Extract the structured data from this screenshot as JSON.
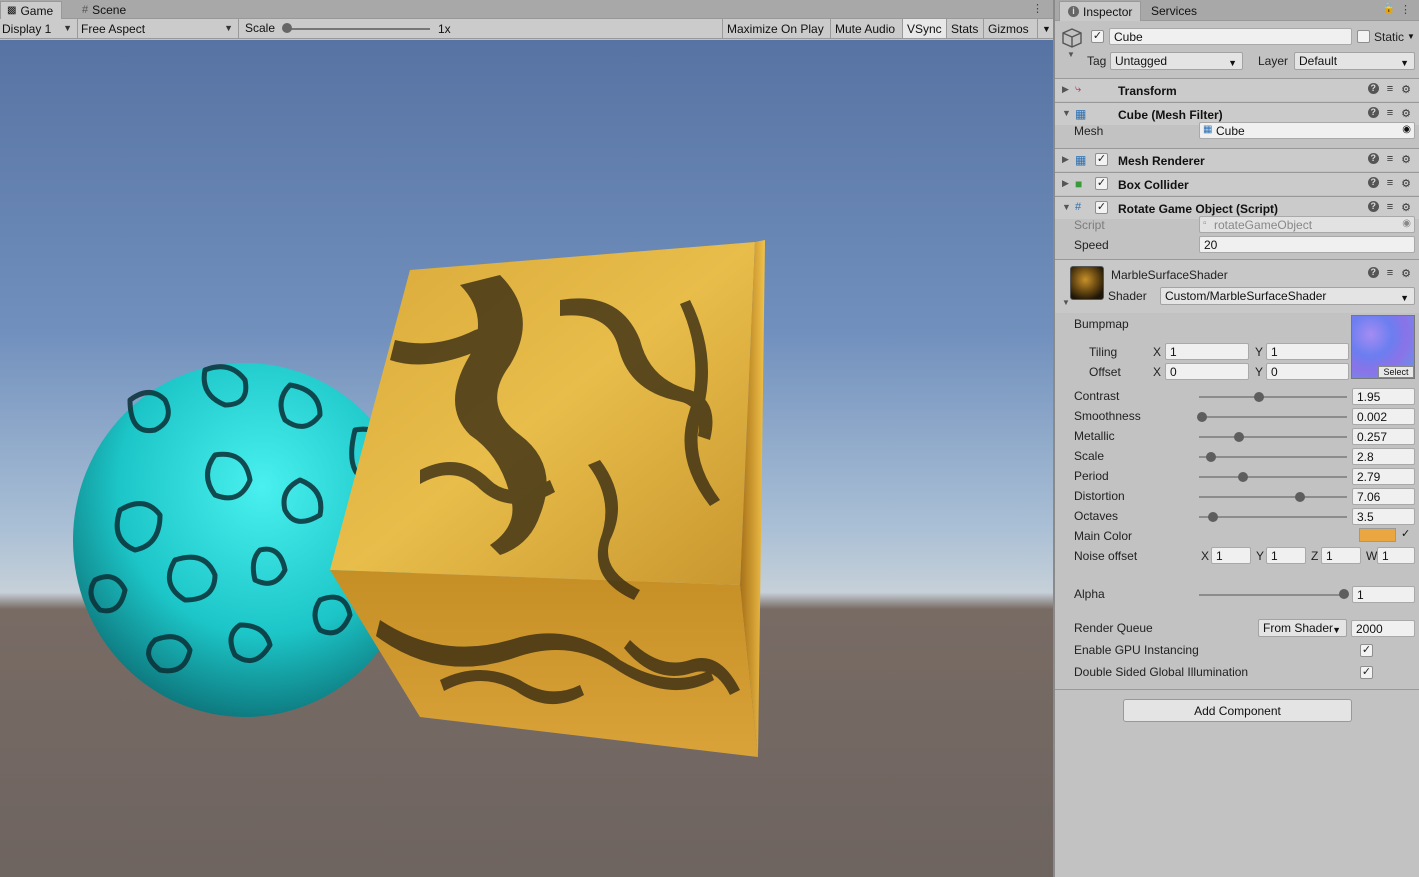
{
  "game_view": {
    "tabs": [
      {
        "label": "Game",
        "icon": "gamepad-icon",
        "active": true
      },
      {
        "label": "Scene",
        "icon": "grid-icon",
        "active": false
      }
    ],
    "toolbar": {
      "display": "Display 1",
      "aspect": "Free Aspect",
      "scale_label": "Scale",
      "scale_value": "1x",
      "buttons": [
        "Maximize On Play",
        "Mute Audio",
        "VSync",
        "Stats",
        "Gizmos"
      ]
    }
  },
  "inspector": {
    "tabs": [
      {
        "label": "Inspector",
        "icon": "info-icon",
        "active": true
      },
      {
        "label": "Services",
        "active": false
      }
    ],
    "object": {
      "name": "Cube",
      "active": true,
      "static_label": "Static",
      "tag_label": "Tag",
      "tag_value": "Untagged",
      "layer_label": "Layer",
      "layer_value": "Default"
    },
    "components": {
      "transform": {
        "title": "Transform"
      },
      "mesh_filter": {
        "title": "Cube (Mesh Filter)",
        "mesh_label": "Mesh",
        "mesh_value": "Cube"
      },
      "mesh_renderer": {
        "title": "Mesh Renderer",
        "enabled": true
      },
      "box_collider": {
        "title": "Box Collider",
        "enabled": true
      },
      "script": {
        "title": "Rotate Game Object (Script)",
        "enabled": true,
        "script_label": "Script",
        "script_value": "rotateGameObject",
        "speed_label": "Speed",
        "speed_value": "20"
      }
    },
    "material": {
      "name": "MarbleSurfaceShader",
      "shader_label": "Shader",
      "shader_value": "Custom/MarbleSurfaceShader",
      "bumpmap_label": "Bumpmap",
      "select_label": "Select",
      "tiling_label": "Tiling",
      "tiling_x": "1",
      "tiling_y": "1",
      "offset_label": "Offset",
      "offset_x": "0",
      "offset_y": "0",
      "x_label": "X",
      "y_label": "Y",
      "z_label": "Z",
      "w_label": "W",
      "sliders": [
        {
          "label": "Contrast",
          "value": "1.95",
          "fraction": 0.4
        },
        {
          "label": "Smoothness",
          "value": "0.002",
          "fraction": 0.0
        },
        {
          "label": "Metallic",
          "value": "0.257",
          "fraction": 0.26
        },
        {
          "label": "Scale",
          "value": "2.8",
          "fraction": 0.06
        },
        {
          "label": "Period",
          "value": "2.79",
          "fraction": 0.29
        },
        {
          "label": "Distortion",
          "value": "7.06",
          "fraction": 0.69
        },
        {
          "label": "Octaves",
          "value": "3.5",
          "fraction": 0.08
        }
      ],
      "main_color_label": "Main Color",
      "main_color": "#eaa641",
      "noise_offset_label": "Noise offset",
      "noise_offset": [
        "1",
        "1",
        "1",
        "1"
      ],
      "alpha_label": "Alpha",
      "alpha_value": "1",
      "alpha_fraction": 1.0,
      "render_queue_label": "Render Queue",
      "render_queue_mode": "From Shader",
      "render_queue_value": "2000",
      "gpu_instancing_label": "Enable GPU Instancing",
      "gpu_instancing": true,
      "double_sided_gi_label": "Double Sided Global Illumination",
      "double_sided_gi": true
    },
    "add_component_label": "Add Component"
  }
}
